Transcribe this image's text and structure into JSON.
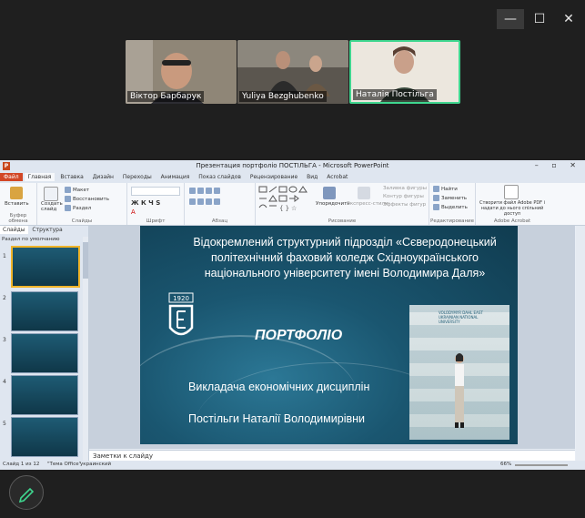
{
  "window": {
    "minimize_glyph": "—",
    "maximize_glyph": "☐",
    "close_glyph": "✕"
  },
  "participants": [
    {
      "name": "Віктор Барбарук"
    },
    {
      "name": "Yuliya Bezghubenko"
    },
    {
      "name": "Наталія Постільга"
    }
  ],
  "powerpoint": {
    "title": "Презентация портфоліо ПОСТІЛЬГА  -  Microsoft PowerPoint",
    "quick_access_letter": "P",
    "window_buttons": "–  ▫  ✕",
    "tabs": [
      "Файл",
      "Главная",
      "Вставка",
      "Дизайн",
      "Переходы",
      "Анимация",
      "Показ слайдов",
      "Рецензирование",
      "Вид",
      "Acrobat"
    ],
    "ribbon": {
      "clipboard": {
        "paste": "Вставить",
        "label": "Буфер обмена"
      },
      "slides": {
        "new_slide": "Создать слайд",
        "layout": "Макет",
        "reset": "Восстановить",
        "section": "Раздел",
        "label": "Слайды"
      },
      "font": {
        "label": "Шрифт"
      },
      "paragraph": {
        "label": "Абзац"
      },
      "drawing": {
        "arrange": "Упорядочить",
        "quick_styles": "Экспресс-стили",
        "fill": "Заливка фигуры",
        "outline": "Контур фигуры",
        "effects": "Эффекты фигур",
        "label": "Рисование"
      },
      "editing": {
        "find": "Найти",
        "replace": "Заменить",
        "select": "Выделить",
        "label": "Редактирование"
      },
      "acrobat": {
        "create": "Створити файл Adobe PDF і надати до нього спільний доступ",
        "label": "Adobe Acrobat"
      }
    },
    "panel": {
      "tab_slides": "Слайды",
      "tab_outline": "Структура",
      "section": "Раздел по умолчанию",
      "thumb_numbers": [
        "1",
        "2",
        "3",
        "4",
        "5"
      ]
    },
    "slide": {
      "heading": "Відокремлений структурний підрозділ «Сєверодонецький політехнічний фаховий коледж Східноукраїнського національного університету імені Володимира Даля»",
      "logo_year": "1920",
      "portfolio": "ПОРТФОЛІО",
      "role": "Викладача економічних дисциплін",
      "name": "Постільги Наталії Володимирівни",
      "banner": "VOLODYMYR DAHL EAST UKRAINIAN NATIONAL UNIVERSITY"
    },
    "notes_placeholder": "Заметки к слайду",
    "status": {
      "slide": "Слайд 1 из 12",
      "theme": "\"Тема Office\"",
      "language": "украинский",
      "zoom": "66%"
    }
  },
  "colors": {
    "active_speaker": "#3fd68f",
    "file_tab": "#d24726",
    "slide_bg": "#1a5670"
  },
  "annotation_tool": {
    "icon": "pen-icon"
  }
}
